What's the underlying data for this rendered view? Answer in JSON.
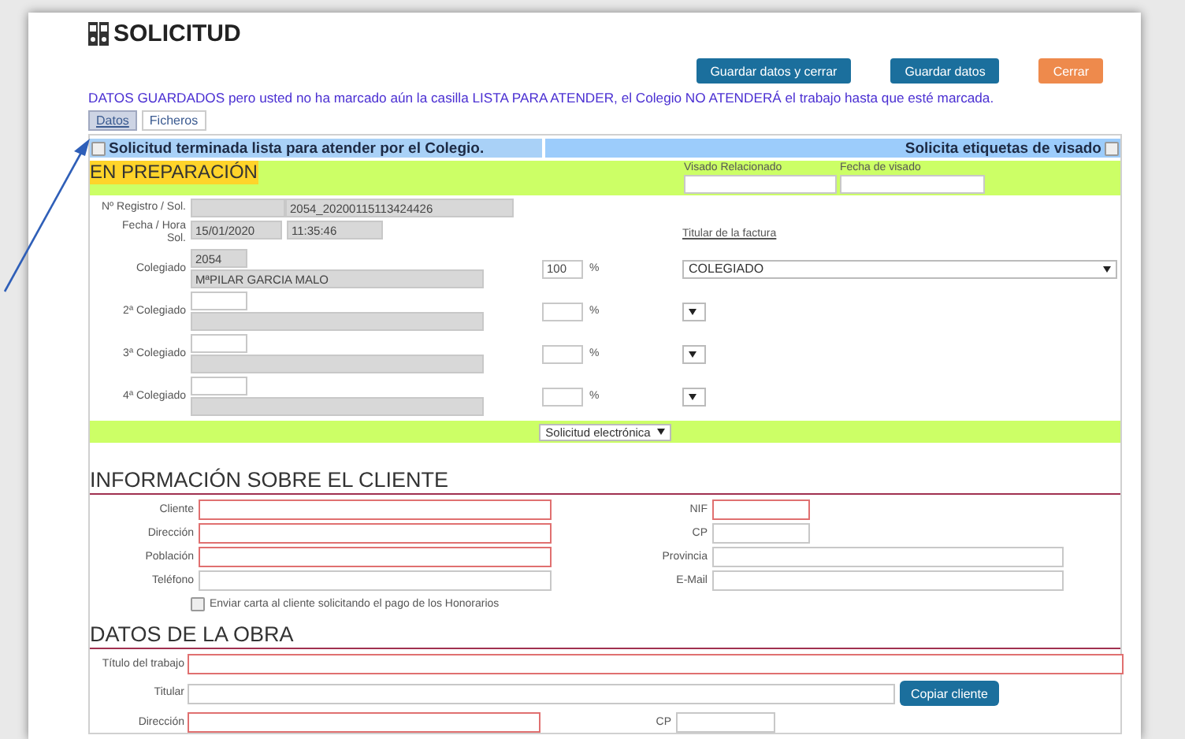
{
  "title": "SOLICITUD",
  "buttons": [
    {
      "label": "Guardar datos y cerrar",
      "kind": "primary"
    },
    {
      "label": "Guardar datos",
      "kind": "primary"
    },
    {
      "label": "Cerrar",
      "kind": "danger"
    }
  ],
  "warning": "DATOS GUARDADOS pero usted no ha marcado aún la casilla LISTA PARA ATENDER, el Colegio NO ATENDERÁ el trabajo hasta que esté marcada.",
  "tabs": [
    {
      "label": "Datos",
      "selected": true
    },
    {
      "label": "Ficheros",
      "selected": false
    }
  ],
  "ready_check": {
    "label": "Solicitud terminada lista para atender por el Colegio.",
    "checked": false
  },
  "labels_check": {
    "label": "Solicita etiquetas de visado",
    "checked": false
  },
  "status": "EN PREPARACIÓN",
  "visado_fields": [
    {
      "label": "Visado Relacionado"
    },
    {
      "label": "Fecha de visado"
    }
  ],
  "registro": {
    "label": "Nº Registro / Sol.",
    "value": "2054_20200115113424426"
  },
  "fecha": {
    "label": "Fecha / Hora Sol.",
    "date": "15/01/2020",
    "time": "11:35:46"
  },
  "invoice_holder": {
    "label": "Titular de la factura",
    "value": "COLEGIADO"
  },
  "colegiados": [
    {
      "label": "Colegiado",
      "number": "2054",
      "name": "MªPILAR GARCIA MALO",
      "percent": "100",
      "unit": "%"
    },
    {
      "label": "2ª Colegiado",
      "unit": "%"
    },
    {
      "label": "3ª Colegiado",
      "unit": "%"
    },
    {
      "label": "4ª Colegiado",
      "unit": "%"
    }
  ],
  "request_type": "Solicitud electrónica",
  "client": {
    "title": "INFORMACIÓN SOBRE EL CLIENTE",
    "rows": [
      {
        "left": {
          "label": "Cliente",
          "required": true
        },
        "right": {
          "label": "NIF",
          "required": true,
          "kind": "short"
        }
      },
      {
        "left": {
          "label": "Dirección",
          "required": true
        },
        "right": {
          "label": "CP",
          "required": false,
          "kind": "short"
        }
      },
      {
        "left": {
          "label": "Población",
          "required": true
        },
        "right": {
          "label": "Provincia",
          "required": false,
          "kind": "long"
        }
      },
      {
        "left": {
          "label": "Teléfono",
          "required": false
        },
        "right": {
          "label": "E-Mail",
          "required": false,
          "kind": "long"
        }
      }
    ],
    "letter_check": {
      "label": "Enviar carta al cliente solicitando el pago de los Honorarios",
      "checked": false
    }
  },
  "obra": {
    "title": "DATOS DE LA OBRA",
    "work_title": {
      "label": "Título del trabajo",
      "required": true
    },
    "holder": {
      "label": "Titular",
      "required": false
    },
    "copy_button": "Copiar cliente",
    "address": {
      "label": "Dirección",
      "required": true
    },
    "cp": {
      "label": "CP",
      "required": false
    }
  }
}
